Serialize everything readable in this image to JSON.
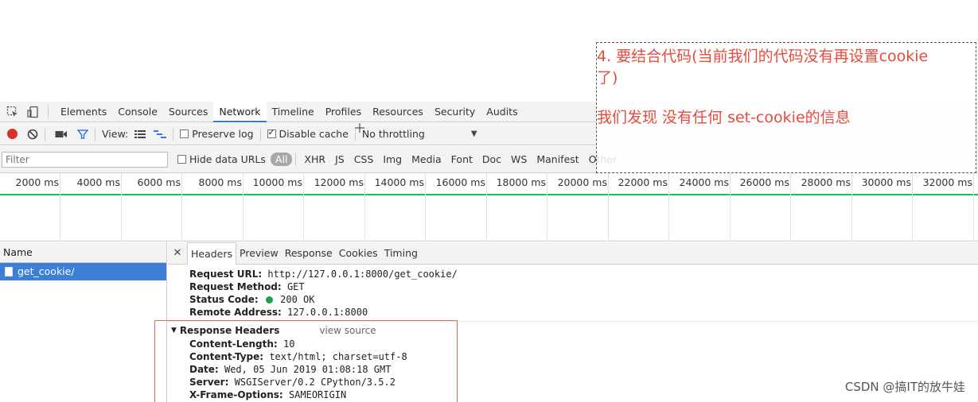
{
  "main_tabs": [
    "Elements",
    "Console",
    "Sources",
    "Network",
    "Timeline",
    "Profiles",
    "Resources",
    "Security",
    "Audits"
  ],
  "toolbar": {
    "view_label": "View:",
    "preserve_log": "Preserve log",
    "disable_cache": "Disable cache",
    "throttling": "No throttling"
  },
  "filter": {
    "placeholder": "Filter",
    "hide_data_urls": "Hide data URLs",
    "types": [
      "All",
      "XHR",
      "JS",
      "CSS",
      "Img",
      "Media",
      "Font",
      "Doc",
      "WS",
      "Manifest",
      "Other"
    ]
  },
  "timeline_ticks": [
    "2000 ms",
    "4000 ms",
    "6000 ms",
    "8000 ms",
    "10000 ms",
    "12000 ms",
    "14000 ms",
    "16000 ms",
    "18000 ms",
    "20000 ms",
    "22000 ms",
    "24000 ms",
    "26000 ms",
    "28000 ms",
    "30000 ms",
    "32000 ms"
  ],
  "requests": {
    "header": "Name",
    "items": [
      "get_cookie/"
    ]
  },
  "detail_tabs": [
    "Headers",
    "Preview",
    "Response",
    "Cookies",
    "Timing"
  ],
  "general": [
    {
      "key": "Request URL:",
      "value": "http://127.0.0.1:8000/get_cookie/"
    },
    {
      "key": "Request Method:",
      "value": "GET"
    },
    {
      "key": "Status Code:",
      "value": "200 OK"
    },
    {
      "key": "Remote Address:",
      "value": "127.0.0.1:8000"
    }
  ],
  "response_headers": {
    "title": "Response Headers",
    "view_source": "view source",
    "items": [
      {
        "key": "Content-Length:",
        "value": "10"
      },
      {
        "key": "Content-Type:",
        "value": "text/html; charset=utf-8"
      },
      {
        "key": "Date:",
        "value": "Wed, 05 Jun 2019 01:08:18 GMT"
      },
      {
        "key": "Server:",
        "value": "WSGIServer/0.2 CPython/3.5.2"
      },
      {
        "key": "X-Frame-Options:",
        "value": "SAMEORIGIN"
      }
    ]
  },
  "annotation": {
    "line1": "4.  要结合代码(当前我们的代码没有再设置cookie",
    "line2": "了)",
    "line3": "我们发现  没有任何  set-cookie的信息"
  },
  "watermark": "CSDN @搞IT的放牛娃",
  "colors": {
    "record": "#d93025",
    "selected_row": "#3b7fd6",
    "timeline_line": "#2db35b",
    "annotation": "#e84a3c",
    "status_ok": "#1aa340"
  }
}
